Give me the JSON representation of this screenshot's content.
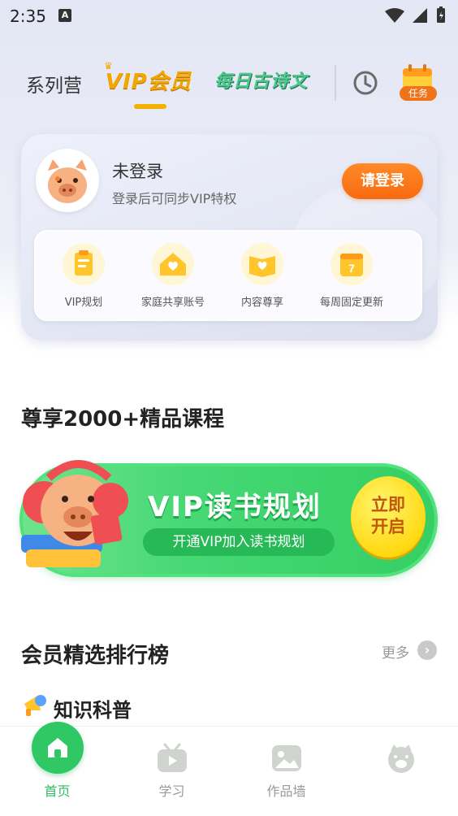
{
  "status_bar": {
    "time": "2:35",
    "notification_letter": "A"
  },
  "header": {
    "tabs": [
      {
        "label": "系列营",
        "active": false
      },
      {
        "label": "VIP会员",
        "active": true
      },
      {
        "label": "每日古诗文",
        "active": false
      }
    ],
    "task_badge": "任务",
    "accent": "#f3b100"
  },
  "user_card": {
    "title": "未登录",
    "subtitle": "登录后可同步VIP特权",
    "login_button": "请登录",
    "benefits": [
      {
        "label": "VIP规划",
        "icon": "clipboard-icon"
      },
      {
        "label": "家庭共享账号",
        "icon": "house-heart-icon"
      },
      {
        "label": "内容尊享",
        "icon": "book-heart-icon"
      },
      {
        "label": "每周固定更新",
        "icon": "calendar-icon"
      }
    ]
  },
  "courses_section": {
    "title": "尊享2000+精品课程"
  },
  "banner": {
    "title": "VIP读书规划",
    "subtitle": "开通VIP加入读书规划",
    "cta_line1": "立即",
    "cta_line2": "开启",
    "color": "#35cf63"
  },
  "ranking_section": {
    "title": "会员精选排行榜",
    "more": "更多",
    "category": "知识科普"
  },
  "bottom_nav": {
    "items": [
      {
        "label": "首页",
        "active": true
      },
      {
        "label": "学习",
        "active": false
      },
      {
        "label": "作品墙",
        "active": false
      },
      {
        "label": "",
        "active": false
      }
    ],
    "active_color": "#2ebd61"
  }
}
